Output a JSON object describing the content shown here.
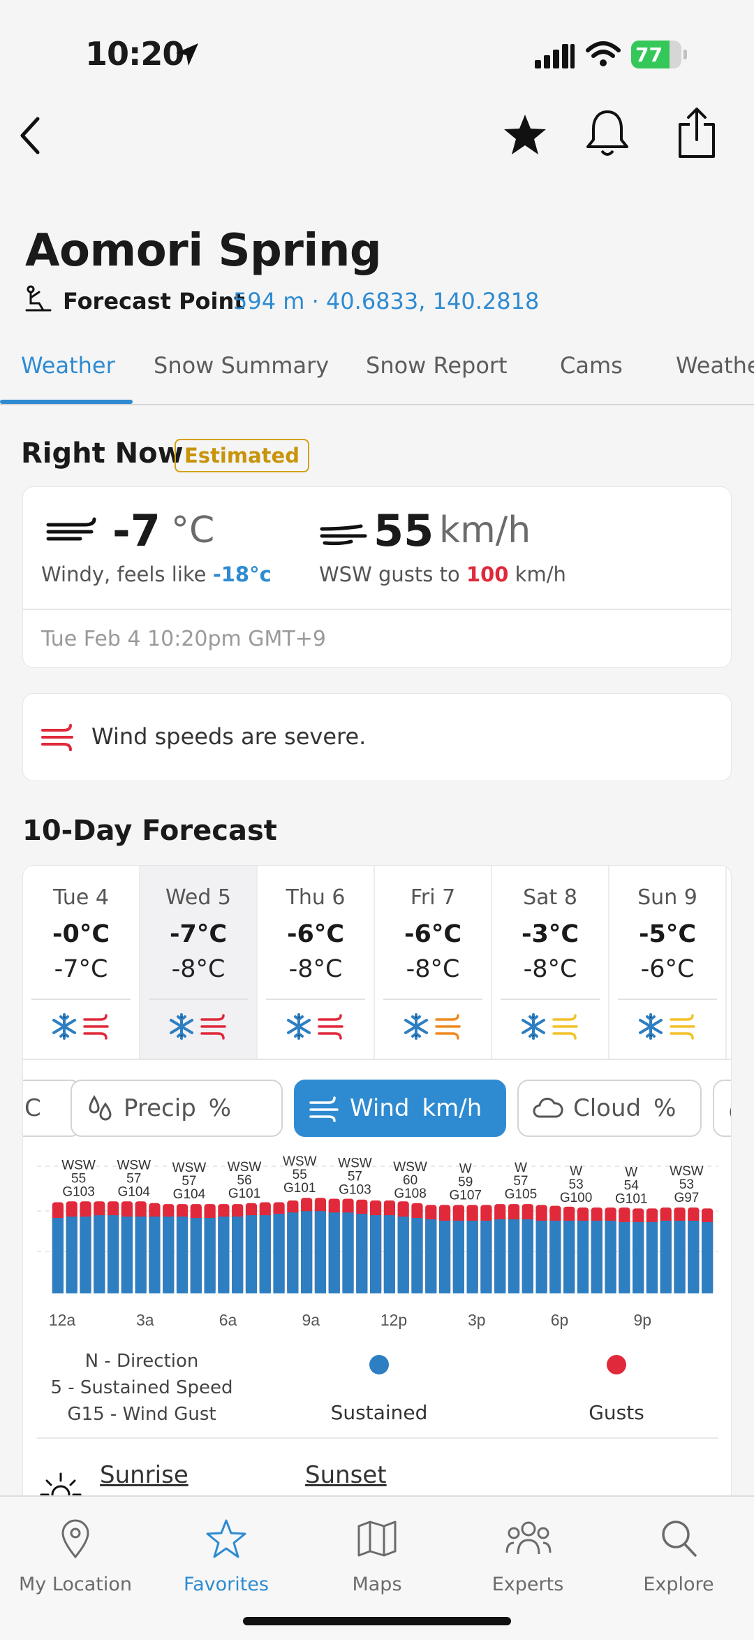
{
  "status": {
    "time": "10:20",
    "battery": "77",
    "battery_level": 0.77
  },
  "header": {
    "title": "Aomori Spring",
    "forecast_point_label": "Forecast Point",
    "forecast_point_info": "594 m · 40.6833, 140.2818"
  },
  "tabs": [
    {
      "label": "Weather",
      "active": true
    },
    {
      "label": "Snow Summary"
    },
    {
      "label": "Snow Report"
    },
    {
      "label": "Cams"
    },
    {
      "label": "Weathe"
    }
  ],
  "right_now": {
    "title": "Right Now",
    "badge": "Estimated",
    "temp": "-7",
    "temp_unit": "°C",
    "feels_prefix": "Windy, feels like ",
    "feels_value": "-18°c",
    "wind": "55",
    "wind_unit": "km/h",
    "gust_prefix": "WSW gusts to ",
    "gust_value": "100",
    "gust_suffix": " km/h",
    "timestamp": "Tue Feb 4 10:20pm GMT+9"
  },
  "alert": {
    "text": "Wind speeds are severe.",
    "color": "#e0293a"
  },
  "forecast": {
    "title": "10-Day Forecast",
    "days": [
      {
        "name": "Tue 4",
        "hi": "-0°C",
        "lo": "-7°C",
        "wind_color": "#e0293a"
      },
      {
        "name": "Wed 5",
        "hi": "-7°C",
        "lo": "-8°C",
        "wind_color": "#e0293a",
        "selected": true
      },
      {
        "name": "Thu 6",
        "hi": "-6°C",
        "lo": "-8°C",
        "wind_color": "#e0293a"
      },
      {
        "name": "Fri 7",
        "hi": "-6°C",
        "lo": "-8°C",
        "wind_color": "#ef8a21"
      },
      {
        "name": "Sat 8",
        "hi": "-3°C",
        "lo": "-8°C",
        "wind_color": "#f2c22a"
      },
      {
        "name": "Sun 9",
        "hi": "-5°C",
        "lo": "-6°C",
        "wind_color": "#f2c22a"
      }
    ]
  },
  "chips": [
    {
      "label": "C",
      "unit": ""
    },
    {
      "label": "Precip",
      "unit": "%"
    },
    {
      "label": "Wind",
      "unit": "km/h",
      "active": true
    },
    {
      "label": "Cloud",
      "unit": "%"
    },
    {
      "label": "",
      "unit": ""
    }
  ],
  "chart_data": {
    "type": "bar",
    "x_labels": [
      "12a",
      "3a",
      "6a",
      "9a",
      "12p",
      "3p",
      "6p",
      "9p"
    ],
    "annotations": [
      {
        "dir": "WSW",
        "sust": "55",
        "gust": "G103"
      },
      {
        "dir": "WSW",
        "sust": "57",
        "gust": "G104"
      },
      {
        "dir": "WSW",
        "sust": "57",
        "gust": "G104"
      },
      {
        "dir": "WSW",
        "sust": "56",
        "gust": "G101"
      },
      {
        "dir": "WSW",
        "sust": "55",
        "gust": "G101"
      },
      {
        "dir": "WSW",
        "sust": "57",
        "gust": "G103"
      },
      {
        "dir": "WSW",
        "sust": "60",
        "gust": "G108"
      },
      {
        "dir": "W",
        "sust": "59",
        "gust": "G107"
      },
      {
        "dir": "W",
        "sust": "57",
        "gust": "G105"
      },
      {
        "dir": "W",
        "sust": "53",
        "gust": "G100"
      },
      {
        "dir": "W",
        "sust": "54",
        "gust": "G101"
      },
      {
        "dir": "WSW",
        "sust": "53",
        "gust": "G97"
      }
    ],
    "sustained": [
      55,
      56,
      56,
      57,
      57,
      56,
      56,
      56,
      56,
      56,
      55,
      55,
      56,
      56,
      57,
      57,
      58,
      59,
      60,
      60,
      59,
      59,
      58,
      57,
      57,
      56,
      55,
      54,
      53,
      53,
      53,
      53,
      54,
      54,
      54,
      53,
      53,
      53,
      53,
      53,
      53,
      52,
      52,
      52,
      53,
      53,
      53,
      52
    ],
    "gusts": [
      103,
      104,
      104,
      104,
      104,
      104,
      104,
      102,
      101,
      101,
      101,
      101,
      101,
      101,
      102,
      103,
      103,
      105,
      108,
      108,
      107,
      107,
      106,
      105,
      105,
      104,
      102,
      100,
      100,
      100,
      100,
      100,
      101,
      101,
      101,
      100,
      99,
      98,
      97,
      97,
      97,
      97,
      96,
      96,
      97,
      97,
      97,
      96
    ],
    "sustained_color": "#2e7fc1",
    "gust_color": "#e0293a",
    "ylim": [
      0,
      120
    ]
  },
  "legend": {
    "line1": "N - Direction",
    "line2": "5 - Sustained Speed",
    "line3": "G15 - Wind Gust",
    "sustained": "Sustained",
    "gusts": "Gusts"
  },
  "sun": {
    "sunrise": "Sunrise",
    "sunset": "Sunset"
  },
  "bottom_nav": [
    {
      "label": "My Location",
      "icon": "pin-icon"
    },
    {
      "label": "Favorites",
      "icon": "star-icon",
      "active": true
    },
    {
      "label": "Maps",
      "icon": "map-icon"
    },
    {
      "label": "Experts",
      "icon": "people-icon"
    },
    {
      "label": "Explore",
      "icon": "search-icon"
    }
  ],
  "colors": {
    "accent": "#2e8bd1",
    "warning": "#e0293a",
    "badge": "#c7940a"
  }
}
